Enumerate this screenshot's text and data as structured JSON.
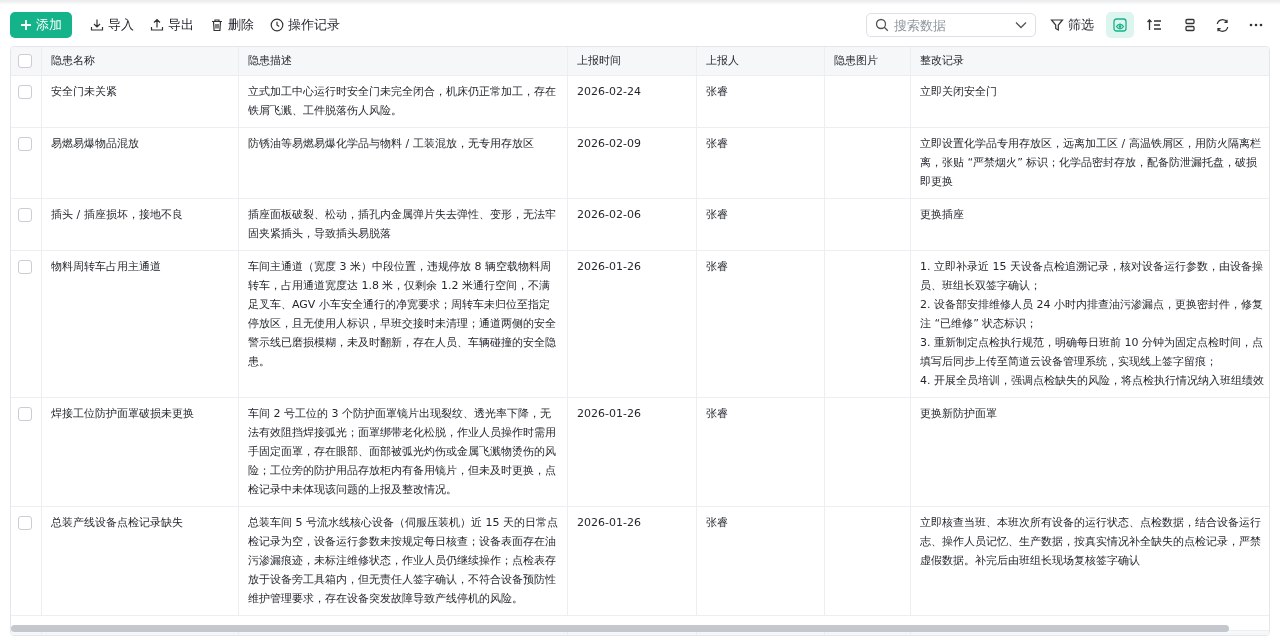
{
  "toolbar": {
    "add_button": {
      "label": "添加"
    },
    "actions": [
      {
        "kind": "import",
        "label": "导入"
      },
      {
        "kind": "export",
        "label": "导出"
      },
      {
        "kind": "delete",
        "label": "删除"
      },
      {
        "kind": "history",
        "label": "操作记录"
      }
    ],
    "search": {
      "placeholder": "搜索数据"
    },
    "filter": {
      "label": "筛选"
    },
    "view_tools": [
      {
        "kind": "display",
        "selected": true
      },
      {
        "kind": "sort",
        "selected": false
      },
      {
        "kind": "group",
        "selected": false
      },
      {
        "kind": "refresh",
        "selected": false
      },
      {
        "kind": "more",
        "selected": false
      }
    ]
  },
  "table": {
    "select_all": {
      "checked": false
    },
    "columns": [
      "隐患名称",
      "隐患描述",
      "上报时间",
      "上报人",
      "隐患图片",
      "整改记录"
    ],
    "rows": [
      {
        "checked": false,
        "name": "安全门未关紧",
        "description": "立式加工中心运行时安全门未完全闭合，机床仍正常加工，存在铁屑飞溅、工件脱落伤人风险。",
        "date": "2026-02-24",
        "reporter": "张睿",
        "rectification": [
          "立即关闭安全门"
        ]
      },
      {
        "checked": false,
        "name": "易燃易爆物品混放",
        "description": "防锈油等易燃易爆化学品与物料 / 工装混放，无专用存放区",
        "date": "2026-02-09",
        "reporter": "张睿",
        "rectification": [
          "立即设置化学品专用存放区，远离加工区 / 高温铁屑区，用防火隔离栏",
          "离，张贴 “严禁烟火” 标识；化学品密封存放，配备防泄漏托盘，破损",
          "即更换"
        ]
      },
      {
        "checked": false,
        "name": "插头 / 插座损坏，接地不良",
        "description": "插座面板破裂、松动，插孔内金属弹片失去弹性、变形，无法牢固夹紧插头，导致插头易脱落",
        "date": "2026-02-06",
        "reporter": "张睿",
        "rectification": [
          "更换插座"
        ]
      },
      {
        "checked": false,
        "name": "物料周转车占用主通道",
        "description": "车间主通道（宽度 3 米）中段位置，违规停放 8 辆空载物料周转车，占用通道宽度达 1.8 米，仅剩余 1.2 米通行空间，不满足叉车、AGV 小车安全通行的净宽要求；周转车未归位至指定停放区，且无使用人标识，早班交接时未清理；通道两侧的安全警示线已磨损模糊，未及时翻新，存在人员、车辆碰撞的安全隐患。",
        "date": "2026-01-26",
        "reporter": "张睿",
        "rectification": [
          "1. 立即补录近 15 天设备点检追溯记录，核对设备运行参数，由设备操",
          "员、班组长双签字确认；",
          "2. 设备部安排维修人员 24 小时内排查油污渗漏点，更换密封件，修复",
          "注 “已维修” 状态标识；",
          "3. 重新制定点检执行规范，明确每日班前 10 分钟为固定点检时间，点",
          "填写后同步上传至简道云设备管理系统，实现线上签字留痕；",
          "4. 开展全员培训，强调点检缺失的风险，将点检执行情况纳入班组绩效"
        ]
      },
      {
        "checked": false,
        "name": "焊接工位防护面罩破损未更换",
        "description": "车间 2 号工位的 3 个防护面罩镜片出现裂纹、透光率下降，无法有效阻挡焊接弧光；面罩绑带老化松脱，作业人员操作时需用手固定面罩，存在眼部、面部被弧光灼伤或金属飞溅物烫伤的风险；工位旁的防护用品存放柜内有备用镜片，但未及时更换，点检记录中未体现该问题的上报及整改情况。",
        "date": "2026-01-26",
        "reporter": "张睿",
        "rectification": [
          "更换新防护面罩"
        ]
      },
      {
        "checked": false,
        "name": "总装产线设备点检记录缺失",
        "description": "总装车间 5 号流水线核心设备（伺服压装机）近 15 天的日常点检记录为空，设备运行参数未按规定每日核查；设备表面存在油污渗漏痕迹，未标注维修状态，作业人员仍继续操作；点检表存放于设备旁工具箱内，但无责任人签字确认，不符合设备预防性维护管理要求，存在设备突发故障导致产线停机的风险。",
        "date": "2026-01-26",
        "reporter": "张睿",
        "rectification": [
          "立即核查当班、本班次所有设备的运行状态、点检数据，结合设备运行",
          "志、操作人员记忆、生产数据，按真实情况补全缺失的点检记录，严禁",
          "虚假数据。补完后由班组长现场复核签字确认"
        ]
      }
    ]
  }
}
